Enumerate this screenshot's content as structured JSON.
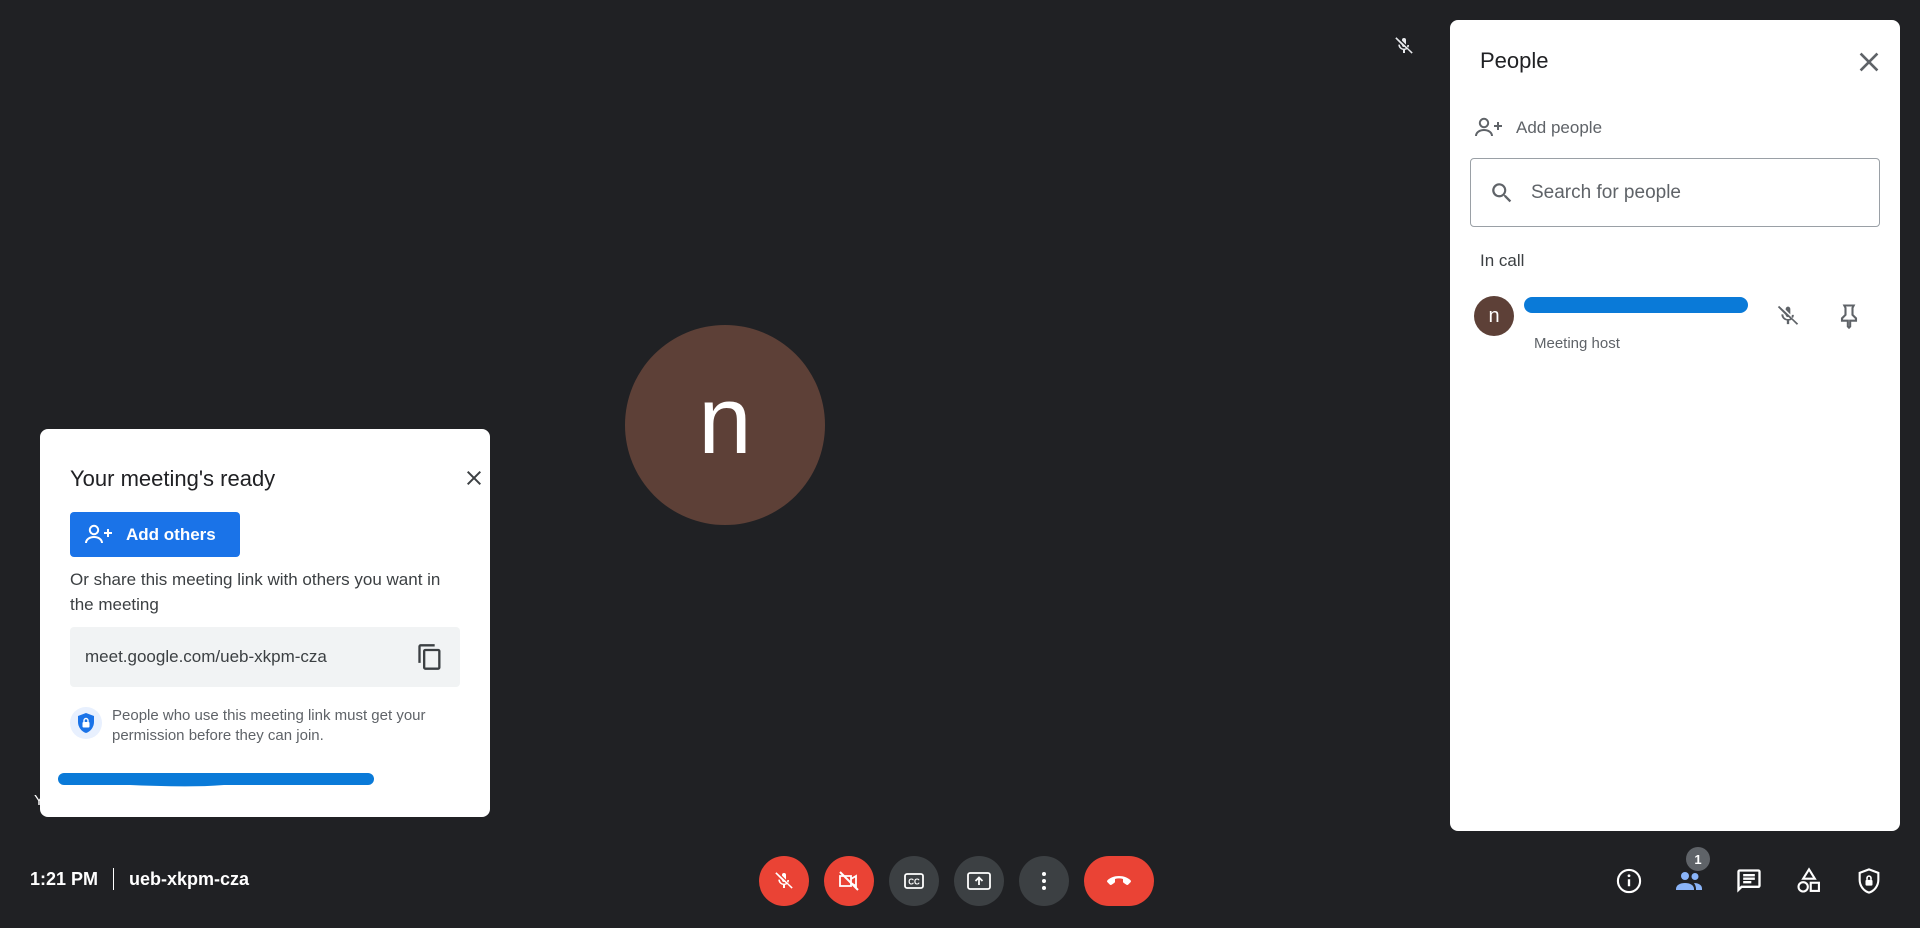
{
  "tile": {
    "initial": "n",
    "hint_char": "Y"
  },
  "ready_card": {
    "title": "Your meeting's ready",
    "add_others_label": "Add others",
    "share_text": "Or share this meeting link with others you want in the meeting",
    "meeting_link": "meet.google.com/ueb-xkpm-cza",
    "permission_text": "People who use this meeting link must get your permission before they can join."
  },
  "people_panel": {
    "title": "People",
    "add_people_label": "Add people",
    "search_placeholder": "Search for people",
    "section_label": "In call",
    "participants": [
      {
        "initial": "n",
        "role": "Meeting host"
      }
    ]
  },
  "bottom_bar": {
    "time": "1:21 PM",
    "meeting_code": "ueb-xkpm-cza",
    "people_count": "1"
  },
  "colors": {
    "background": "#202124",
    "accent_blue": "#1a73e8",
    "danger_red": "#ea4335",
    "avatar_brown": "#5d4037",
    "redaction_blue": "#0a7ad8"
  },
  "icons": {
    "self_mic": "mic-off-icon",
    "close": "close-icon",
    "add_person": "person-add-icon",
    "copy": "copy-icon",
    "shield": "shield-lock-icon",
    "search": "search-icon",
    "pin": "pin-icon",
    "controls": [
      "mic-off-icon",
      "videocam-off-icon",
      "closed-caption-icon",
      "present-screen-icon",
      "more-vert-icon",
      "call-end-icon"
    ],
    "right_controls": [
      "info-icon",
      "people-icon",
      "chat-icon",
      "activities-icon",
      "host-controls-icon"
    ]
  }
}
